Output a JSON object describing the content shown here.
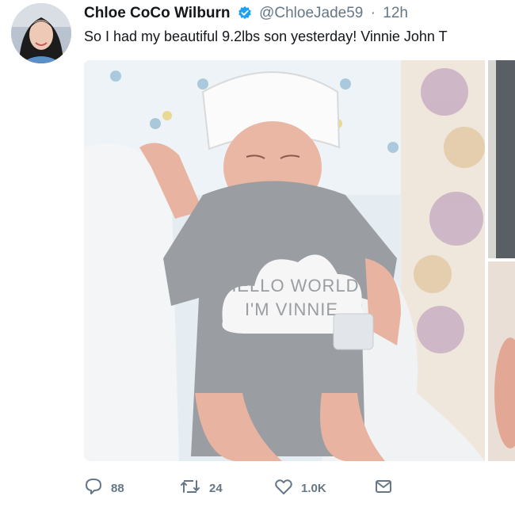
{
  "tweet": {
    "author_name": "Chloe CoCo Wilburn",
    "handle": "@ChloeJade59",
    "separator": "·",
    "time": "12h",
    "text": "So I had my beautiful 9.2lbs son yesterday! Vinnie John T",
    "media": {
      "onesie_line1": "HELLO WORLD",
      "onesie_line2": "I'M VINNIE"
    }
  },
  "actions": {
    "reply_count": "88",
    "retweet_count": "24",
    "like_count": "1.0K"
  },
  "colors": {
    "verified": "#1da1f2",
    "muted": "#657786",
    "text": "#14171a"
  },
  "icons": [
    "avatar",
    "verified-badge-icon",
    "reply-icon",
    "retweet-icon",
    "like-icon",
    "direct-message-icon"
  ]
}
